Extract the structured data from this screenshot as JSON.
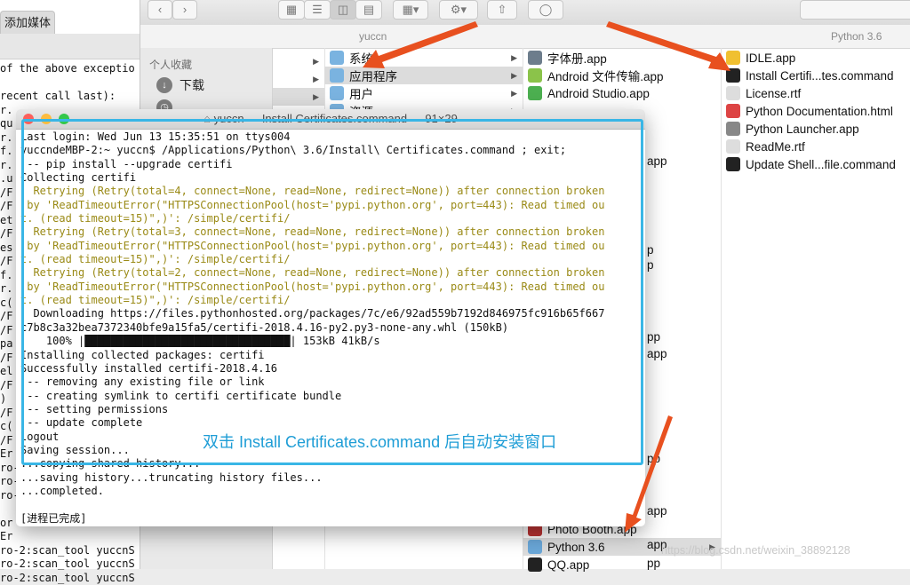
{
  "background_window": {
    "tab_label": "添加媒体",
    "lines": [
      "of the above exceptio",
      "",
      "recent call last):",
      "r.",
      "qu",
      "r.",
      "f.",
      "r.",
      ".u",
      "/F",
      "/F",
      "et",
      "/F",
      "es",
      "/F",
      "f.",
      "r.",
      "c(",
      "/F",
      "/F",
      "pa",
      "/F",
      "el",
      "/F",
      ")",
      "/F",
      "c(",
      "/F",
      "Er",
      "ro-2:scan_tool yuccnS",
      "ro-2:scan_tool yuccnS",
      "ro-2:scan_tool yuccnS",
      "",
      "or",
      "Er",
      "ro-2:scan_tool yuccnS",
      "ro-2:scan_tool yuccnS",
      "ro-2:scan_tool yuccnS"
    ]
  },
  "finder": {
    "path_left": "yuccn",
    "path_right": "Python 3.6",
    "sidebar": {
      "section": "个人收藏",
      "items": [
        {
          "label": "下载",
          "icon": "download-icon"
        }
      ]
    },
    "col1": [
      "",
      "",
      "",
      ""
    ],
    "col2": [
      {
        "label": "系统",
        "icon": "folder-icon",
        "arrow": true
      },
      {
        "label": "应用程序",
        "icon": "folder-icon",
        "arrow": true,
        "selected": true
      },
      {
        "label": "用户",
        "icon": "folder-icon",
        "arrow": true
      },
      {
        "label": "资源",
        "icon": "folder-icon",
        "arrow": true
      }
    ],
    "col3": [
      {
        "label": "字体册.app",
        "icon": "app-icon",
        "color": "#6d7d8c"
      },
      {
        "label": "Android 文件传输.app",
        "icon": "android-icon",
        "color": "#8bc34a"
      },
      {
        "label": "Android Studio.app",
        "icon": "android-studio-icon",
        "color": "#4caf50"
      }
    ],
    "col3_partial": [
      "app",
      "p",
      "p",
      "pp",
      "app",
      "pp",
      "app",
      "pp",
      "app"
    ],
    "col3_bottom": [
      {
        "label": "Photo Booth.app",
        "icon": "app-icon",
        "color": "#b33"
      },
      {
        "label": "Python 3.6",
        "icon": "folder-icon",
        "color": "#6aa7d8",
        "selected": true,
        "arrow": true
      },
      {
        "label": "QQ.app",
        "icon": "qq-icon",
        "color": "#222"
      }
    ],
    "col4": [
      {
        "label": "IDLE.app",
        "icon": "idle-icon",
        "color": "#f0c030"
      },
      {
        "label": "Install Certifi...tes.command",
        "icon": "command-icon",
        "color": "#222"
      },
      {
        "label": "License.rtf",
        "icon": "document-icon",
        "color": "#ddd"
      },
      {
        "label": "Python Documentation.html",
        "icon": "chrome-icon",
        "color": "#d44"
      },
      {
        "label": "Python Launcher.app",
        "icon": "rocket-icon",
        "color": "#888"
      },
      {
        "label": "ReadMe.rtf",
        "icon": "document-icon",
        "color": "#ddd"
      },
      {
        "label": "Update Shell...file.command",
        "icon": "command-icon",
        "color": "#222"
      }
    ]
  },
  "terminal": {
    "title": "yuccn — Install Certificates.command — 91×29",
    "lines": [
      {
        "t": "Last login: Wed Jun 13 15:35:51 on ttys004",
        "c": "n"
      },
      {
        "t": "yuccndeMBP-2:~ yuccn$ /Applications/Python\\ 3.6/Install\\ Certificates.command ; exit;",
        "c": "n"
      },
      {
        "t": " -- pip install --upgrade certifi",
        "c": "n"
      },
      {
        "t": "Collecting certifi",
        "c": "n"
      },
      {
        "t": "  Retrying (Retry(total=4, connect=None, read=None, redirect=None)) after connection broken",
        "c": "w"
      },
      {
        "t": " by 'ReadTimeoutError(\"HTTPSConnectionPool(host='pypi.python.org', port=443): Read timed ou",
        "c": "w"
      },
      {
        "t": "t. (read timeout=15)\",)': /simple/certifi/",
        "c": "w"
      },
      {
        "t": "  Retrying (Retry(total=3, connect=None, read=None, redirect=None)) after connection broken",
        "c": "w"
      },
      {
        "t": " by 'ReadTimeoutError(\"HTTPSConnectionPool(host='pypi.python.org', port=443): Read timed ou",
        "c": "w"
      },
      {
        "t": "t. (read timeout=15)\",)': /simple/certifi/",
        "c": "w"
      },
      {
        "t": "  Retrying (Retry(total=2, connect=None, read=None, redirect=None)) after connection broken",
        "c": "w"
      },
      {
        "t": " by 'ReadTimeoutError(\"HTTPSConnectionPool(host='pypi.python.org', port=443): Read timed ou",
        "c": "w"
      },
      {
        "t": "t. (read timeout=15)\",)': /simple/certifi/",
        "c": "w"
      },
      {
        "t": "  Downloading https://files.pythonhosted.org/packages/7c/e6/92ad559b7192d846975fc916b65f667",
        "c": "n"
      },
      {
        "t": "c7b8c3a32bea7372340bfe9a15fa5/certifi-2018.4.16-py2.py3-none-any.whl (150kB)",
        "c": "n"
      },
      {
        "t": "    100% |████████████████████████████████| 153kB 41kB/s",
        "c": "n"
      },
      {
        "t": "Installing collected packages: certifi",
        "c": "n"
      },
      {
        "t": "Successfully installed certifi-2018.4.16",
        "c": "n"
      },
      {
        "t": " -- removing any existing file or link",
        "c": "n"
      },
      {
        "t": " -- creating symlink to certifi certificate bundle",
        "c": "n"
      },
      {
        "t": " -- setting permissions",
        "c": "n"
      },
      {
        "t": " -- update complete",
        "c": "n"
      },
      {
        "t": "logout",
        "c": "n"
      },
      {
        "t": "Saving session...",
        "c": "n"
      },
      {
        "t": "...copying shared history...",
        "c": "n"
      },
      {
        "t": "...saving history...truncating history files...",
        "c": "n"
      },
      {
        "t": "...completed.",
        "c": "n"
      },
      {
        "t": "",
        "c": "n"
      },
      {
        "t": "[进程已完成]",
        "c": "n"
      }
    ]
  },
  "caption": "双击 Install Certificates.command 后自动安装窗口",
  "watermark": "https://blog.csdn.net/weixin_38892128",
  "colors": {
    "arrow": "#e8501f",
    "highlight": "#39b6e6",
    "caption": "#1e9dd6"
  }
}
